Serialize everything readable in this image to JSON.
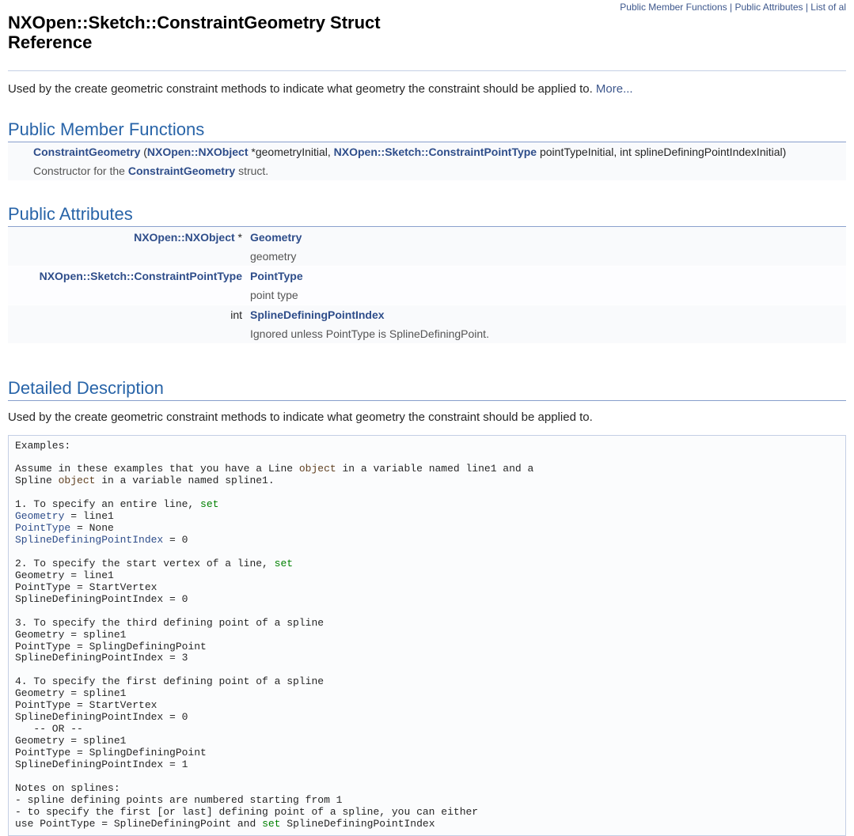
{
  "toplinks": {
    "pmf": "Public Member Functions",
    "pa": "Public Attributes",
    "loa": "List of al"
  },
  "title": "NXOpen::Sketch::ConstraintGeometry Struct Reference",
  "brief": {
    "text": "Used by the create geometric constraint methods to indicate what geometry the constraint should be applied to. ",
    "more": "More..."
  },
  "sections": {
    "pmf": "Public Member Functions",
    "pa": "Public Attributes",
    "dd": "Detailed Description"
  },
  "func": {
    "name": "ConstraintGeometry",
    "paren_open": " (",
    "p1type": "NXOpen::NXObject",
    "p1rest": " *geometryInitial, ",
    "p2type": "NXOpen::Sketch::ConstraintPointType",
    "p2rest": " pointTypeInitial, int splineDefiningPointIndexInitial)",
    "desc_pre": "Constructor for the ",
    "desc_link": "ConstraintGeometry",
    "desc_post": " struct."
  },
  "attrs": [
    {
      "type_link": "NXOpen::NXObject",
      "type_suffix": " * ",
      "name": "Geometry",
      "desc": "geometry"
    },
    {
      "type_link": "NXOpen::Sketch::ConstraintPointType",
      "type_suffix": " ",
      "name": "PointType",
      "desc": "point type"
    },
    {
      "type_link": "",
      "type_suffix": "int ",
      "name": "SplineDefiningPointIndex",
      "desc": "Ignored unless PointType is SplineDefiningPoint."
    }
  ],
  "detailed": {
    "text": "Used by the create geometric constraint methods to indicate what geometry the constraint should be applied to."
  },
  "code": {
    "l0": "Examples:",
    "l1": "",
    "l2a": "Assume in these examples that you have a Line ",
    "l2b": "object",
    "l2c": " in a variable named line1 and a",
    "l3a": "Spline ",
    "l3b": "object",
    "l3c": " in a variable named spline1.",
    "l4": "",
    "l5a": "1. To specify an entire line, ",
    "l5b": "set",
    "l6a": "Geometry",
    "l6b": " = line1",
    "l7a": "PointType",
    "l7b": " = None",
    "l8a": "SplineDefiningPointIndex",
    "l8b": " = 0",
    "l9": "",
    "l10a": "2. To specify the start vertex of a line, ",
    "l10b": "set",
    "l11": "Geometry = line1",
    "l12": "PointType = StartVertex",
    "l13": "SplineDefiningPointIndex = 0",
    "l14": "",
    "l15": "3. To specify the third defining point of a spline",
    "l16": "Geometry = spline1",
    "l17": "PointType = SplingDefiningPoint",
    "l18": "SplineDefiningPointIndex = 3",
    "l19": "",
    "l20": "4. To specify the first defining point of a spline",
    "l21": "Geometry = spline1",
    "l22": "PointType = StartVertex",
    "l23": "SplineDefiningPointIndex = 0",
    "l24": "   -- OR --",
    "l25": "Geometry = spline1",
    "l26": "PointType = SplingDefiningPoint",
    "l27": "SplineDefiningPointIndex = 1",
    "l28": "",
    "l29": "Notes on splines:",
    "l30": "- spline defining points are numbered starting from 1",
    "l31": "- to specify the first [or last] defining point of a spline, you can either",
    "l32a": "use PointType = SplineDefiningPoint and ",
    "l32b": "set",
    "l32c": " SplineDefiningPointIndex"
  }
}
